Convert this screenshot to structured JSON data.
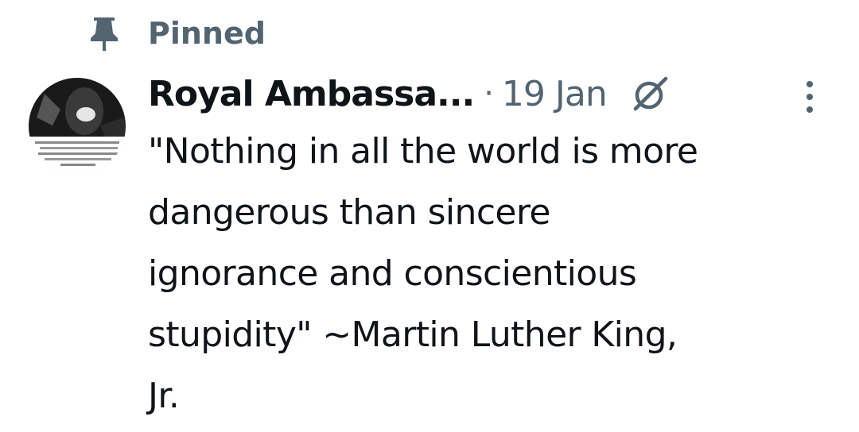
{
  "pinned": {
    "label": "Pinned",
    "icon": "pin-icon"
  },
  "author": {
    "name": "Royal Ambassa...",
    "avatar_icon": "avatar"
  },
  "post": {
    "separator": "·",
    "date": "19 Jan",
    "grok_icon": "grok-icon",
    "more_icon": "more-vertical-icon",
    "text_lines": [
      "\"Nothing in all the world is more",
      "dangerous than sincere",
      "ignorance and conscientious",
      "stupidity\" ~Martin Luther King,",
      "Jr."
    ]
  },
  "colors": {
    "text_primary": "#0f1419",
    "text_secondary": "#536471",
    "background": "#ffffff"
  }
}
